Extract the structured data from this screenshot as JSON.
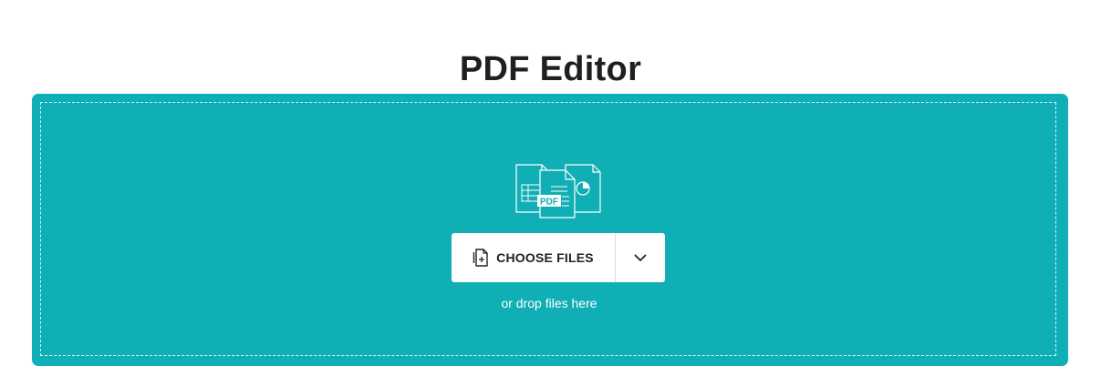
{
  "page": {
    "title": "PDF Editor"
  },
  "upload": {
    "choose_files_label": "CHOOSE FILES",
    "drop_hint": "or drop files here",
    "illustration_badge": "PDF",
    "icons": {
      "illustration": "documents-illustration-icon",
      "add_file": "file-add-icon",
      "dropdown": "chevron-down-icon"
    }
  },
  "colors": {
    "drop_zone": "#10afb5",
    "button_bg": "#ffffff",
    "title": "#1f1f1f"
  }
}
